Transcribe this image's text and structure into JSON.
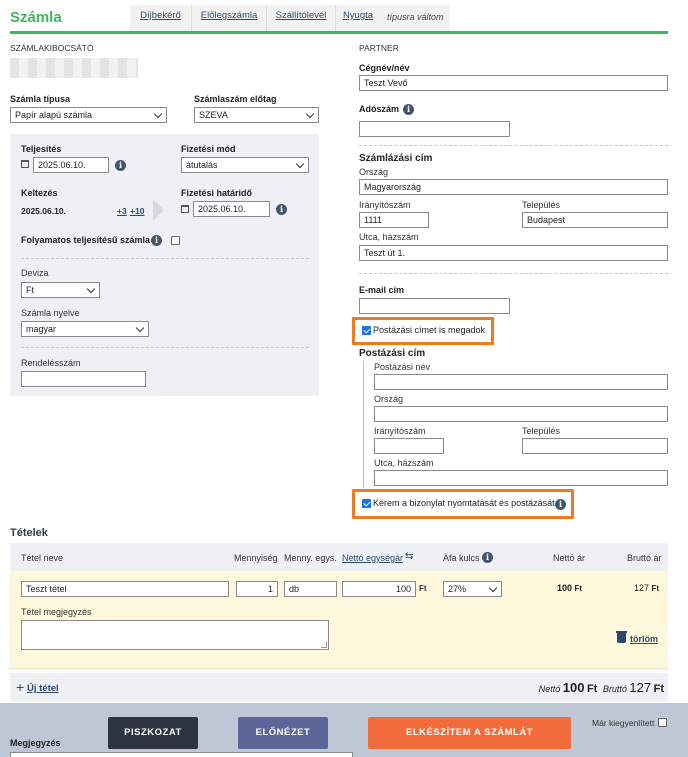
{
  "header": {
    "title": "Számla",
    "tabs": [
      "Díjbekérő",
      "Előlegszámla",
      "Szállítólevél",
      "Nyugta"
    ],
    "type_switch": "típusra váltom"
  },
  "issuer": {
    "section_label": "SZÁMLAKIBOCSÁTÓ",
    "invoice_type_label": "Számla típusa",
    "invoice_type_value": "Papír alapú számla",
    "prefix_label": "Számlaszám előtag",
    "prefix_value": "SZEVA",
    "completion_label": "Teljesítés",
    "completion_value": "2025.06.10.",
    "payment_mode_label": "Fizetési mód",
    "payment_mode_value": "átutalás",
    "issue_date_label": "Keltezés",
    "issue_date_value": "2025.06.10.",
    "plus3": "+3",
    "plus10": "+10",
    "due_label": "Fizetési határidő",
    "due_value": "2025.06.10.",
    "continuous_label": "Folyamatos teljesítésű számla",
    "currency_label": "Deviza",
    "currency_value": "Ft",
    "language_label": "Számla nyelve",
    "language_value": "magyar",
    "order_label": "Rendelésszám",
    "order_value": ""
  },
  "partner": {
    "section_label": "PARTNER",
    "company_label": "Cégnév/név",
    "company_value": "Teszt Vevő",
    "tax_label": "Adószám",
    "tax_value": "",
    "billing_title": "Számlázási cím",
    "country_label": "Ország",
    "country_value": "Magyarország",
    "zip_label": "Irányítószám",
    "zip_value": "1111",
    "city_label": "Település",
    "city_value": "Budapest",
    "street_label": "Utca, házszám",
    "street_value": "Teszt út 1.",
    "email_label": "E-mail cím",
    "email_value": "",
    "postal_checkbox_label": "Postázási címet is megadok",
    "postal_title": "Postázási cím",
    "postal_name_label": "Postázási név",
    "postal_country_label": "Ország",
    "postal_zip_label": "Irányítószám",
    "postal_city_label": "Település",
    "postal_street_label": "Utca, házszám",
    "print_checkbox_label": "Kérem a bizonylat nyomtatását és postázását"
  },
  "items": {
    "title": "Tételek",
    "columns": {
      "name": "Tétel neve",
      "qty": "Mennyiség",
      "unit": "Menny. egys.",
      "unit_price": "Nettó egységár",
      "vat": "Áfa kulcs",
      "net": "Nettó ár",
      "gross": "Bruttó ár"
    },
    "row": {
      "name": "Teszt tétel",
      "qty": "1",
      "unit": "db",
      "unit_price": "100",
      "currency": "Ft",
      "vat": "27%",
      "net_amount": "100",
      "net_currency": "Ft",
      "gross_amount": "127",
      "gross_currency": "Ft",
      "note_label": "Tétel megjegyzés",
      "delete_label": "törlöm"
    },
    "add_item": "Új tétel",
    "total_net_label": "Nettó",
    "total_net_value": "100",
    "total_gross_label": "Bruttó",
    "total_gross_value": "127",
    "total_currency": "Ft"
  },
  "footer": {
    "draft_button": "PISZKOZAT",
    "preview_button": "ELŐNÉZET",
    "create_button": "ELKÉSZÍTEM A SZÁMLÁT",
    "paid_label": "Már kiegyenlített",
    "note_label": "Megjegyzés"
  },
  "colors": {
    "brand_green": "#3cb55e",
    "highlight_orange": "#f07a1e",
    "create_button": "#f26b3a",
    "preview_button": "#5c6698",
    "draft_button": "#2e3444"
  }
}
